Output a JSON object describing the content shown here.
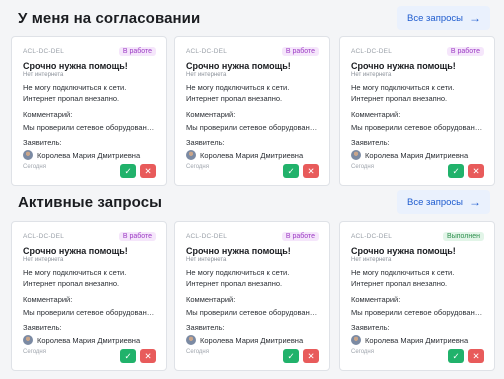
{
  "sections": [
    {
      "title": "У меня на согласовании",
      "button": {
        "label": "Все запросы",
        "icon": "arrow-right-icon"
      },
      "cards": [
        {
          "code": "ACL-DC-DEL",
          "status": "В работе",
          "status_type": "inwork",
          "title": "Срочно нужна помощь!",
          "subtitle": "Нет интернета",
          "desc1": "Не могу подключиться к сети.",
          "desc2": "Интернет пропал внезапно.",
          "comment_label": "Комментарий:",
          "comment": "Мы проверили сетевое оборудовани...",
          "applicant_label": "Заявитель:",
          "applicant": "Королева Мария Дмитриевна",
          "date": "Сегодня"
        },
        {
          "code": "ACL-DC-DEL",
          "status": "В работе",
          "status_type": "inwork",
          "title": "Срочно нужна помощь!",
          "subtitle": "Нет интернета",
          "desc1": "Не могу подключиться к сети.",
          "desc2": "Интернет пропал внезапно.",
          "comment_label": "Комментарий:",
          "comment": "Мы проверили сетевое оборудовани...",
          "applicant_label": "Заявитель:",
          "applicant": "Королева Мария Дмитриевна",
          "date": "Сегодня"
        },
        {
          "code": "ACL-DC-DEL",
          "status": "В работе",
          "status_type": "inwork",
          "title": "Срочно нужна помощь!",
          "subtitle": "Нет интернета",
          "desc1": "Не могу подключиться к сети.",
          "desc2": "Интернет пропал внезапно.",
          "comment_label": "Комментарий:",
          "comment": "Мы проверили сетевое оборудовани...",
          "applicant_label": "Заявитель:",
          "applicant": "Королева Мария Дмитриевна",
          "date": "Сегодня"
        }
      ]
    },
    {
      "title": "Активные запросы",
      "button": {
        "label": "Все запросы",
        "icon": "arrow-right-icon"
      },
      "cards": [
        {
          "code": "ACL-DC-DEL",
          "status": "В работе",
          "status_type": "inwork",
          "title": "Срочно нужна помощь!",
          "subtitle": "Нет интернета",
          "desc1": "Не могу подключиться к сети.",
          "desc2": "Интернет пропал внезапно.",
          "comment_label": "Комментарий:",
          "comment": "Мы проверили сетевое оборудовани...",
          "applicant_label": "Заявитель:",
          "applicant": "Королева Мария Дмитриевна",
          "date": "Сегодня"
        },
        {
          "code": "ACL-DC-DEL",
          "status": "В работе",
          "status_type": "inwork",
          "title": "Срочно нужна помощь!",
          "subtitle": "Нет интернета",
          "desc1": "Не могу подключиться к сети.",
          "desc2": "Интернет пропал внезапно.",
          "comment_label": "Комментарий:",
          "comment": "Мы проверили сетевое оборудовани...",
          "applicant_label": "Заявитель:",
          "applicant": "Королева Мария Дмитриевна",
          "date": "Сегодня"
        },
        {
          "code": "ACL-DC-DEL",
          "status": "Выполнен",
          "status_type": "done",
          "title": "Срочно нужна помощь!",
          "subtitle": "Нет интернета",
          "desc1": "Не могу подключиться к сети.",
          "desc2": "Интернет пропал внезапно.",
          "comment_label": "Комментарий:",
          "comment": "Мы проверили сетевое оборудовани...",
          "applicant_label": "Заявитель:",
          "applicant": "Королева Мария Дмитриевна",
          "date": "Сегодня"
        }
      ]
    }
  ],
  "actions": {
    "approve_icon": "check-icon",
    "approve_glyph": "✓",
    "reject_icon": "close-icon",
    "reject_glyph": "✕"
  },
  "colors": {
    "status_inwork": "#9c3ac4",
    "status_done": "#2e8f4d",
    "approve": "#21b26b",
    "reject": "#e85b5b",
    "accent": "#1f5ccf"
  }
}
